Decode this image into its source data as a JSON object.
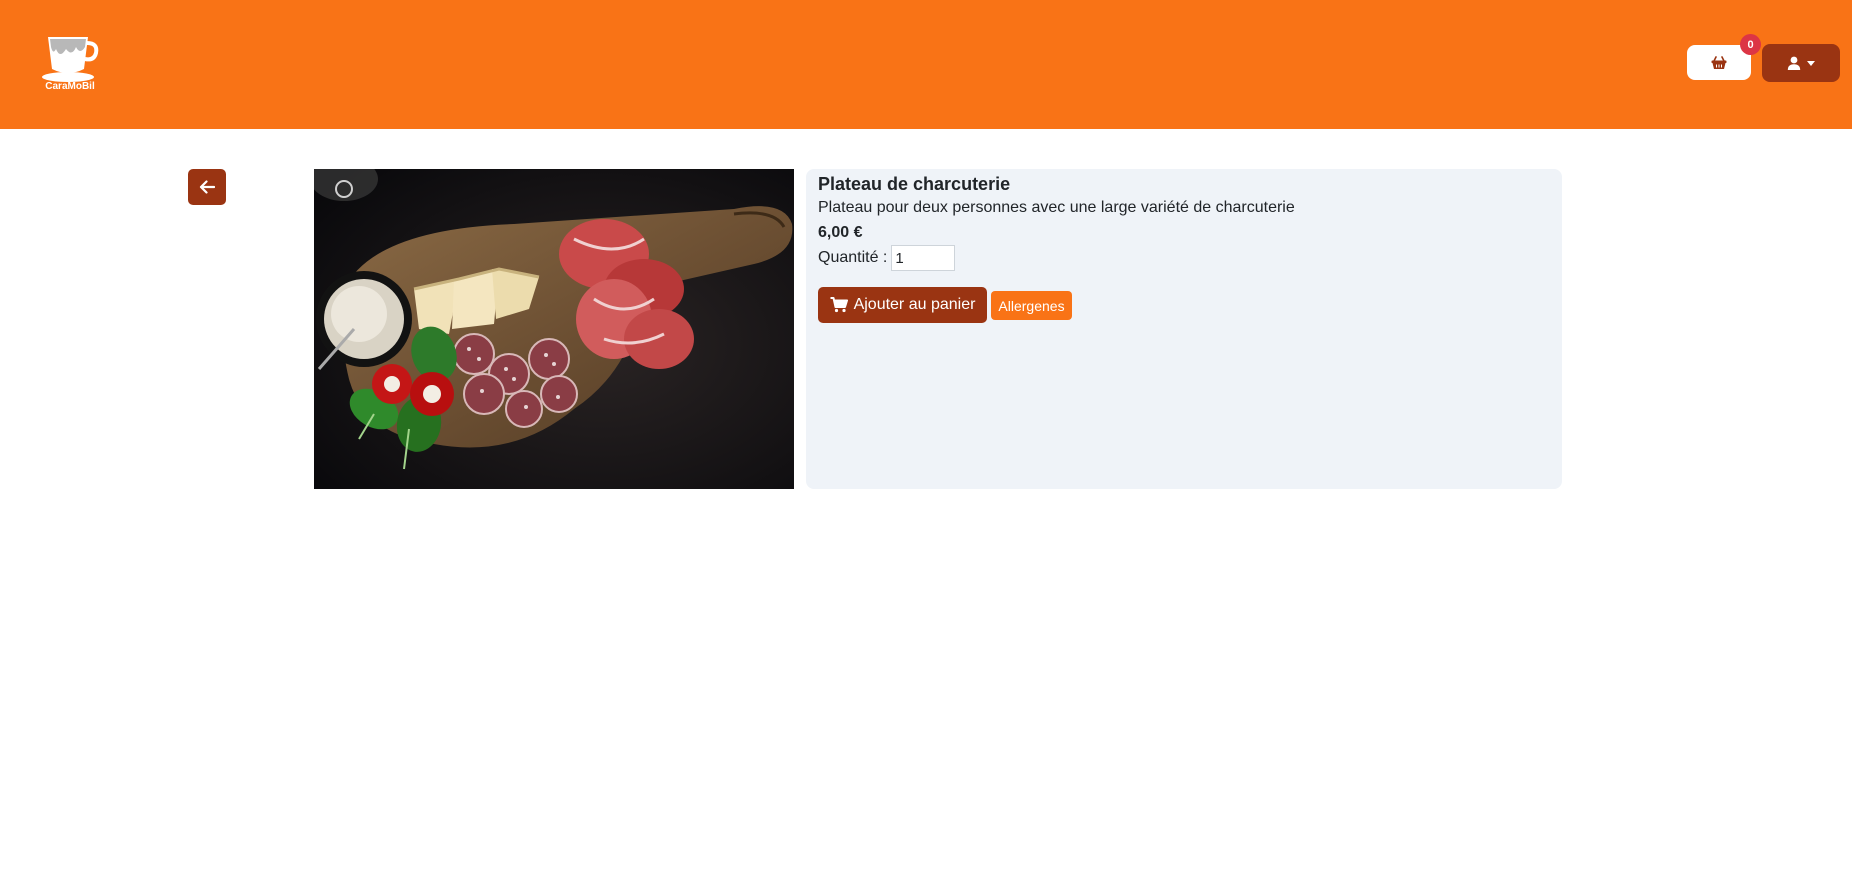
{
  "header": {
    "logo_text": "CaraMoBil",
    "logo_icon": "coffee-cup-logo",
    "cart": {
      "icon": "basket-icon",
      "badge_count": "0"
    },
    "user_menu": {
      "icon": "user-icon",
      "caret_icon": "caret-down-icon"
    }
  },
  "back": {
    "icon": "arrow-left-icon"
  },
  "product": {
    "name": "Plateau de charcuterie",
    "description": "Plateau pour deux personnes avec une large variété de charcuterie",
    "price": "6,00 €",
    "quantity_label": "Quantité :",
    "quantity_value": "1",
    "add_to_cart_label": "Ajouter au panier",
    "add_to_cart_icon": "cart-icon",
    "allergens_label": "Allergenes"
  },
  "colors": {
    "brand_orange": "#f97316",
    "brand_brown": "#9a3412",
    "card_bg": "#eff3f8",
    "badge_red": "#dc3545"
  }
}
